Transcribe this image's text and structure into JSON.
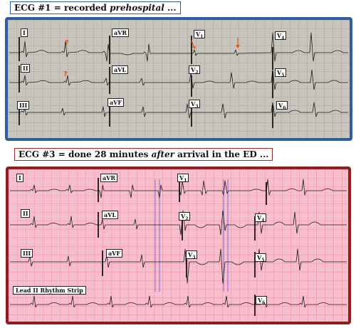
{
  "ecg1": {
    "caption_prefix": "ECG #1 = recorded ",
    "caption_emphasis": "prehospital",
    "caption_suffix": " ...",
    "leads": {
      "I": "I",
      "II": "II",
      "III": "III",
      "aVR": "aVR",
      "aVL": "aVL",
      "aVF": "aVF",
      "V1": "V",
      "V1_sub": "1",
      "V2": "V",
      "V2_sub": "2",
      "V3": "V",
      "V3_sub": "3",
      "V4": "V",
      "V4_sub": "4",
      "V5": "V",
      "V5_sub": "5",
      "V6": "V",
      "V6_sub": "6"
    },
    "annotations": [
      "?",
      "?"
    ],
    "colors": {
      "frame": "#2d5f9e",
      "paper": "#cdcbc3",
      "annotation": "#e8541a"
    }
  },
  "ecg3": {
    "caption_prefix": "ECG #3 = done 28 minutes ",
    "caption_emphasis": "after",
    "caption_suffix": " arrival in the ED ...",
    "leads": {
      "I": "I",
      "II": "II",
      "III": "III",
      "aVR": "aVR",
      "aVL": "aVL",
      "aVF": "aVF",
      "V1": "V",
      "V1_sub": "1",
      "V2": "V",
      "V2_sub": "2",
      "V3": "V",
      "V3_sub": "3",
      "V4": "V",
      "V4_sub": "4",
      "V5": "V",
      "V5_sub": "5",
      "V6": "V",
      "V6_sub": "6"
    },
    "rhythm_label": "Lead II Rhythm Strip",
    "colors": {
      "frame": "#8e1f1f",
      "paper": "#f7c9d4",
      "guide_lines": "#5a5ad8"
    }
  }
}
